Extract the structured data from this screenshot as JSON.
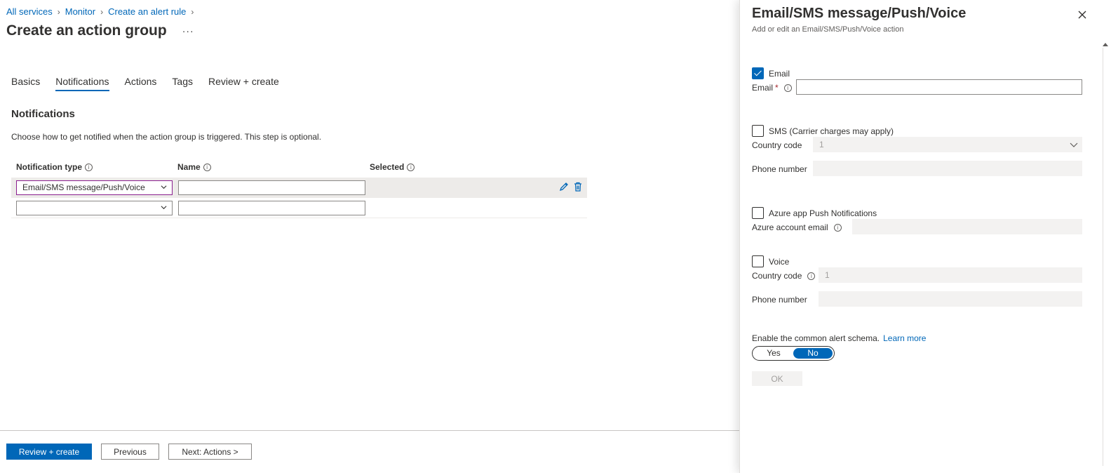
{
  "breadcrumb": {
    "items": [
      "All services",
      "Monitor",
      "Create an alert rule"
    ]
  },
  "page": {
    "title": "Create an action group",
    "more": "···"
  },
  "tabs": [
    "Basics",
    "Notifications",
    "Actions",
    "Tags",
    "Review + create"
  ],
  "notifications": {
    "title": "Notifications",
    "description": "Choose how to get notified when the action group is triggered. This step is optional.",
    "columns": [
      "Notification type",
      "Name",
      "Selected"
    ],
    "rows": [
      {
        "type": "Email/SMS message/Push/Voice",
        "name": ""
      },
      {
        "type": "",
        "name": ""
      }
    ]
  },
  "footer": {
    "review": "Review + create",
    "previous": "Previous",
    "next": "Next: Actions >"
  },
  "blade": {
    "title": "Email/SMS message/Push/Voice",
    "subtitle": "Add or edit an Email/SMS/Push/Voice action",
    "email": {
      "checkbox": "Email",
      "label": "Email",
      "required": "*",
      "value": ""
    },
    "sms": {
      "checkbox": "SMS (Carrier charges may apply)",
      "country_label": "Country code",
      "country_value": "1",
      "phone_label": "Phone number"
    },
    "push": {
      "checkbox": "Azure app Push Notifications",
      "account_label": "Azure account email"
    },
    "voice": {
      "checkbox": "Voice",
      "country_label": "Country code",
      "country_value": "1",
      "phone_label": "Phone number"
    },
    "schema": {
      "label": "Enable the common alert schema.",
      "link": "Learn more",
      "yes": "Yes",
      "no": "No",
      "selected": "No"
    },
    "ok": "OK"
  },
  "colors": {
    "accent": "#0067b8",
    "focus_border": "#8a1e8e",
    "required": "#a4262c"
  }
}
